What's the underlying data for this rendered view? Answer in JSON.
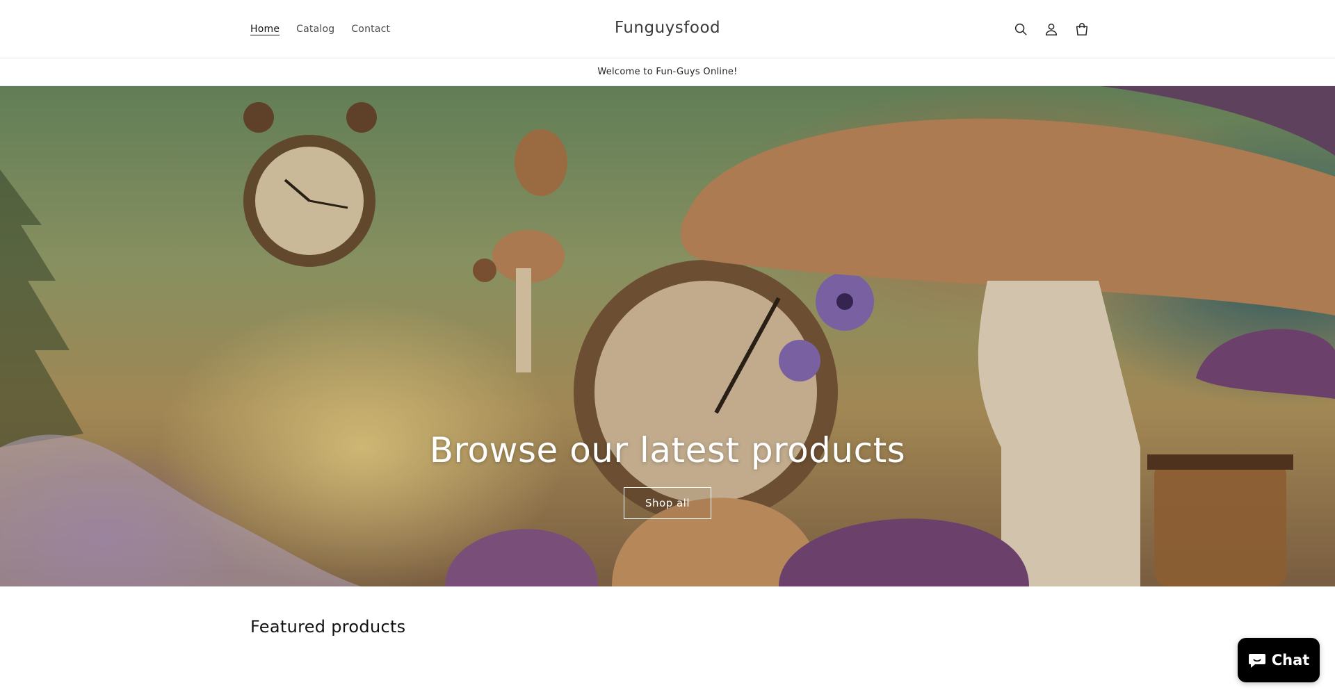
{
  "header": {
    "nav": [
      {
        "label": "Home",
        "active": true
      },
      {
        "label": "Catalog",
        "active": false
      },
      {
        "label": "Contact",
        "active": false
      }
    ],
    "brand": "Funguysfood",
    "icons": [
      "search-icon",
      "account-icon",
      "cart-icon"
    ]
  },
  "announcement": "Welcome to Fun-Guys Online!",
  "hero": {
    "title": "Browse our latest products",
    "button_label": "Shop all"
  },
  "featured": {
    "heading": "Featured products"
  },
  "chat": {
    "label": "Chat",
    "icon": "chat-bubble-icon",
    "color": "#000000"
  }
}
